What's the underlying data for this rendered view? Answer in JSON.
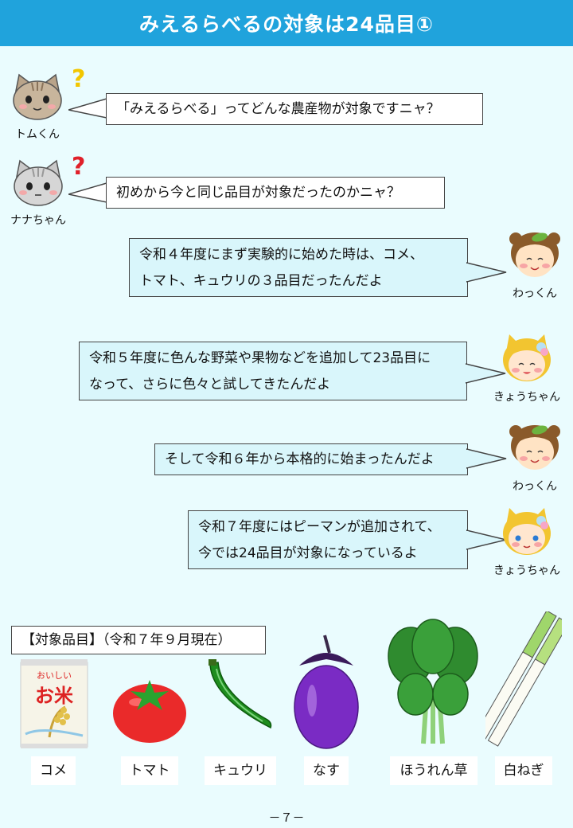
{
  "header": {
    "title": "みえるらべるの対象は24品目①"
  },
  "speakers": {
    "tom": "トムくん",
    "nana": "ナナちゃん",
    "waku": "わっくん",
    "kyou": "きょうちゃん"
  },
  "dialogue": {
    "tom": "「みえるらべる」ってどんな農産物が対象ですニャ？",
    "nana": "初めから今と同じ品目が対象だったのかニャ？",
    "waku1_line1": "令和４年度にまず実験的に始めた時は、コメ、",
    "waku1_line2": "トマト、キュウリの３品目だったんだよ",
    "kyou1_line1": "令和５年度に色んな野菜や果物などを追加して23品目に",
    "kyou1_line2": "なって、さらに色々と試してきたんだよ",
    "waku2": "そして令和６年から本格的に始まったんだよ",
    "kyou2_line1": "令和７年度にはピーマンが追加されて、",
    "kyou2_line2": "今では24品目が対象になっているよ"
  },
  "items_heading": "【対象品目】（令和７年９月現在）",
  "rice_bag": {
    "top_text": "おいしい",
    "main_text": "お米"
  },
  "items": [
    "コメ",
    "トマト",
    "キュウリ",
    "なす",
    "ほうれん草",
    "白ねぎ"
  ],
  "page_number": "－７－",
  "colors": {
    "header": "#20a3dc",
    "background": "#eafcfe",
    "bubble_blue": "#d9f6fb"
  }
}
